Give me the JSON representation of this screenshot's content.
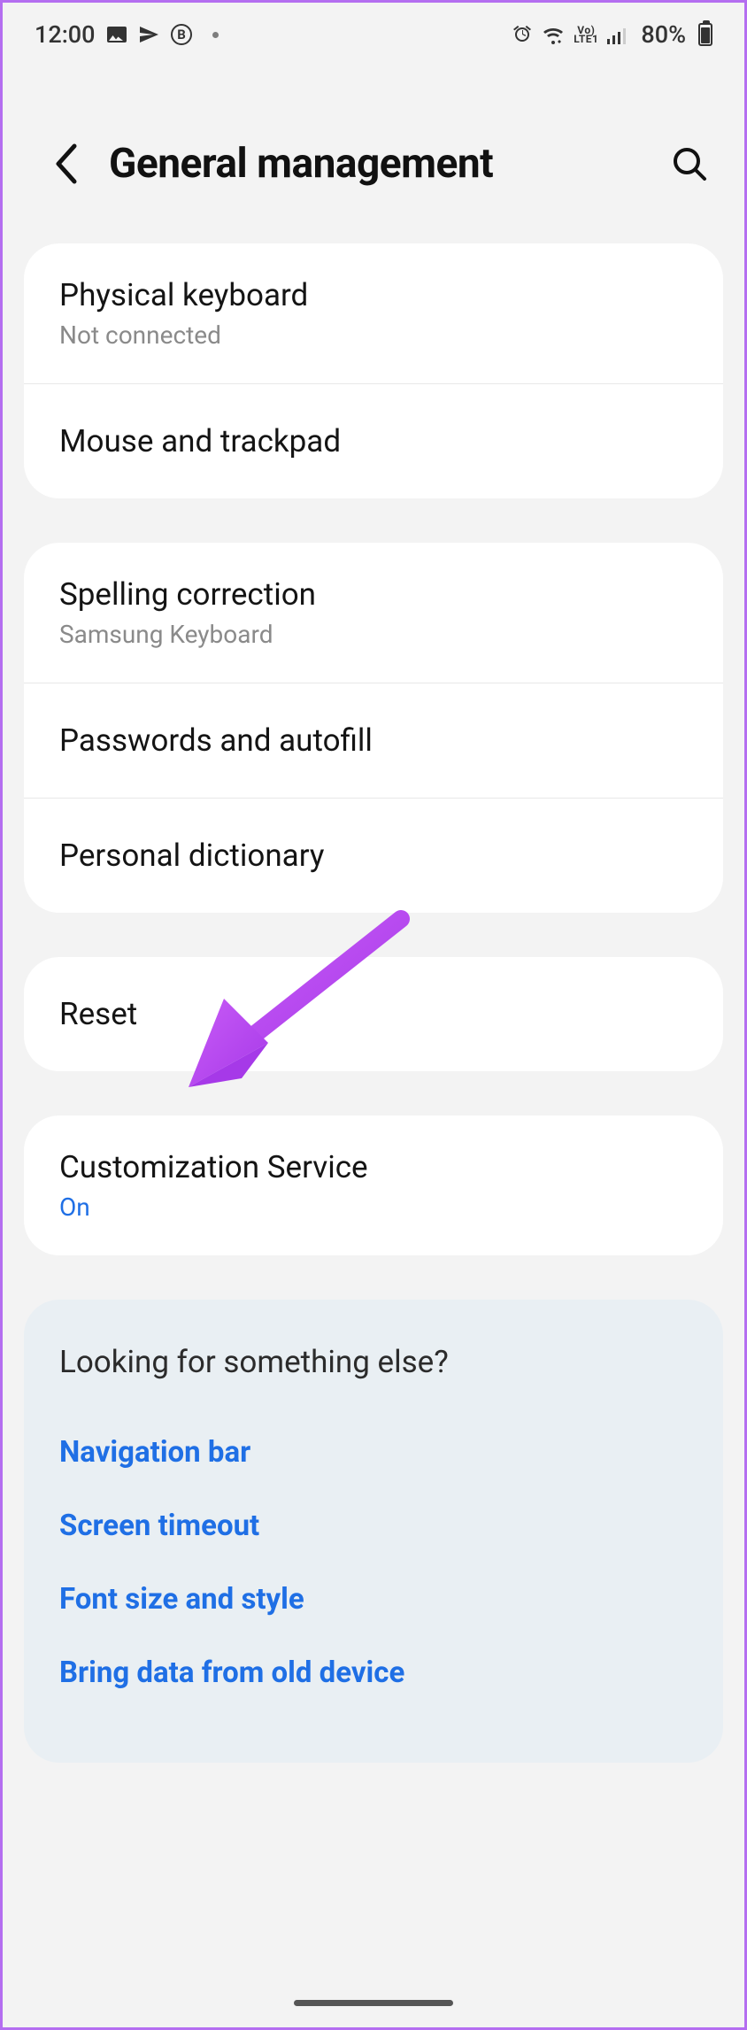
{
  "status": {
    "time": "12:00",
    "battery_pct": "80%"
  },
  "header": {
    "title": "General management"
  },
  "group1": {
    "item0": {
      "title": "Physical keyboard",
      "sub": "Not connected"
    },
    "item1": {
      "title": "Mouse and trackpad"
    }
  },
  "group2": {
    "item0": {
      "title": "Spelling correction",
      "sub": "Samsung Keyboard"
    },
    "item1": {
      "title": "Passwords and autofill"
    },
    "item2": {
      "title": "Personal dictionary"
    }
  },
  "group3": {
    "item0": {
      "title": "Reset"
    }
  },
  "group4": {
    "item0": {
      "title": "Customization Service",
      "sub": "On"
    }
  },
  "lookfor": {
    "title": "Looking for something else?",
    "links": {
      "l0": "Navigation bar",
      "l1": "Screen timeout",
      "l2": "Font size and style",
      "l3": "Bring data from old device"
    }
  }
}
